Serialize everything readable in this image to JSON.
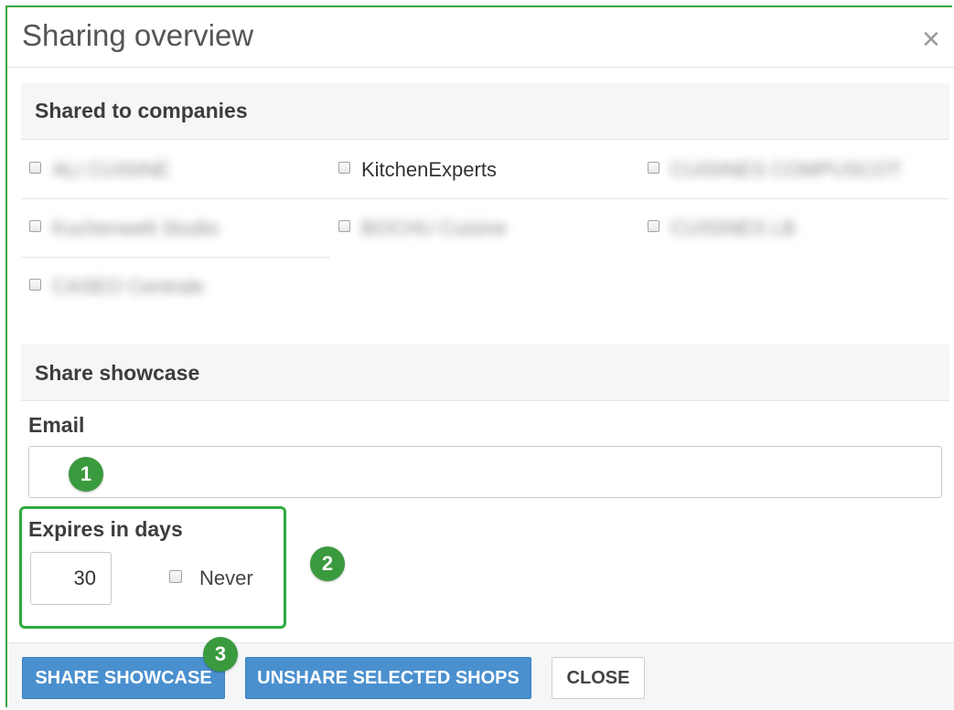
{
  "dialog": {
    "title": "Sharing overview",
    "close_glyph": "×"
  },
  "companies": {
    "heading": "Shared to companies",
    "items": [
      {
        "label": "ALI CUISINE",
        "checked": false,
        "blurred": true
      },
      {
        "label": "KitchenExperts",
        "checked": false,
        "blurred": false
      },
      {
        "label": "CUISINES COMPUSCOT",
        "checked": false,
        "blurred": true
      },
      {
        "label": "Kuchenwelt Studio",
        "checked": false,
        "blurred": true
      },
      {
        "label": "BOCHU Cuisine",
        "checked": false,
        "blurred": true
      },
      {
        "label": "CUISINES LB",
        "checked": false,
        "blurred": true
      },
      {
        "label": "CASEO Centrale",
        "checked": false,
        "blurred": true
      }
    ]
  },
  "showcase": {
    "heading": "Share showcase",
    "email_label": "Email",
    "email_value": "",
    "expires_label": "Expires in days",
    "expires_value": "30",
    "never_label": "Never",
    "never_checked": false
  },
  "badges": [
    "1",
    "2",
    "3"
  ],
  "footer": {
    "share_label": "SHARE SHOWCASE",
    "unshare_label": "UNSHARE SELECTED SHOPS",
    "close_label": "CLOSE"
  },
  "colors": {
    "primary_button": "#4a90cf",
    "highlight_green": "#2eaa3f",
    "badge_green": "#3a9a3e"
  }
}
